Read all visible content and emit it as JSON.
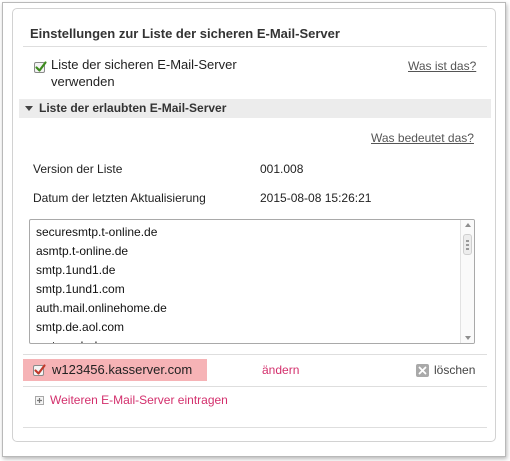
{
  "settings": {
    "title": "Einstellungen zur Liste der sicheren E-Mail-Server",
    "use_list_label": "Liste der sicheren E-Mail-Server verwenden",
    "use_list_checked": true,
    "what_is_link": "Was ist das?"
  },
  "allowed_section": {
    "title": "Liste der erlaubten E-Mail-Server",
    "meaning_link": "Was bedeutet das?",
    "version_label": "Version der Liste",
    "version_value": "001.008",
    "updated_label": "Datum der letzten Aktualisierung",
    "updated_value": "2015-08-08 15:26:21",
    "servers": [
      "securesmtp.t-online.de",
      "asmtp.t-online.de",
      "smtp.1und1.de",
      "smtp.1und1.com",
      "auth.mail.onlinehome.de",
      "smtp.de.aol.com"
    ]
  },
  "custom_server": {
    "name": "w123456.kasserver.com",
    "checked": true,
    "edit_label": "ändern",
    "delete_label": "löschen"
  },
  "add_server": {
    "label": "Weiteren E-Mail-Server eintragen"
  },
  "colors": {
    "accent": "#d32f6c",
    "highlight": "#f6b3b6",
    "checkmark": "#3d8b1d"
  }
}
